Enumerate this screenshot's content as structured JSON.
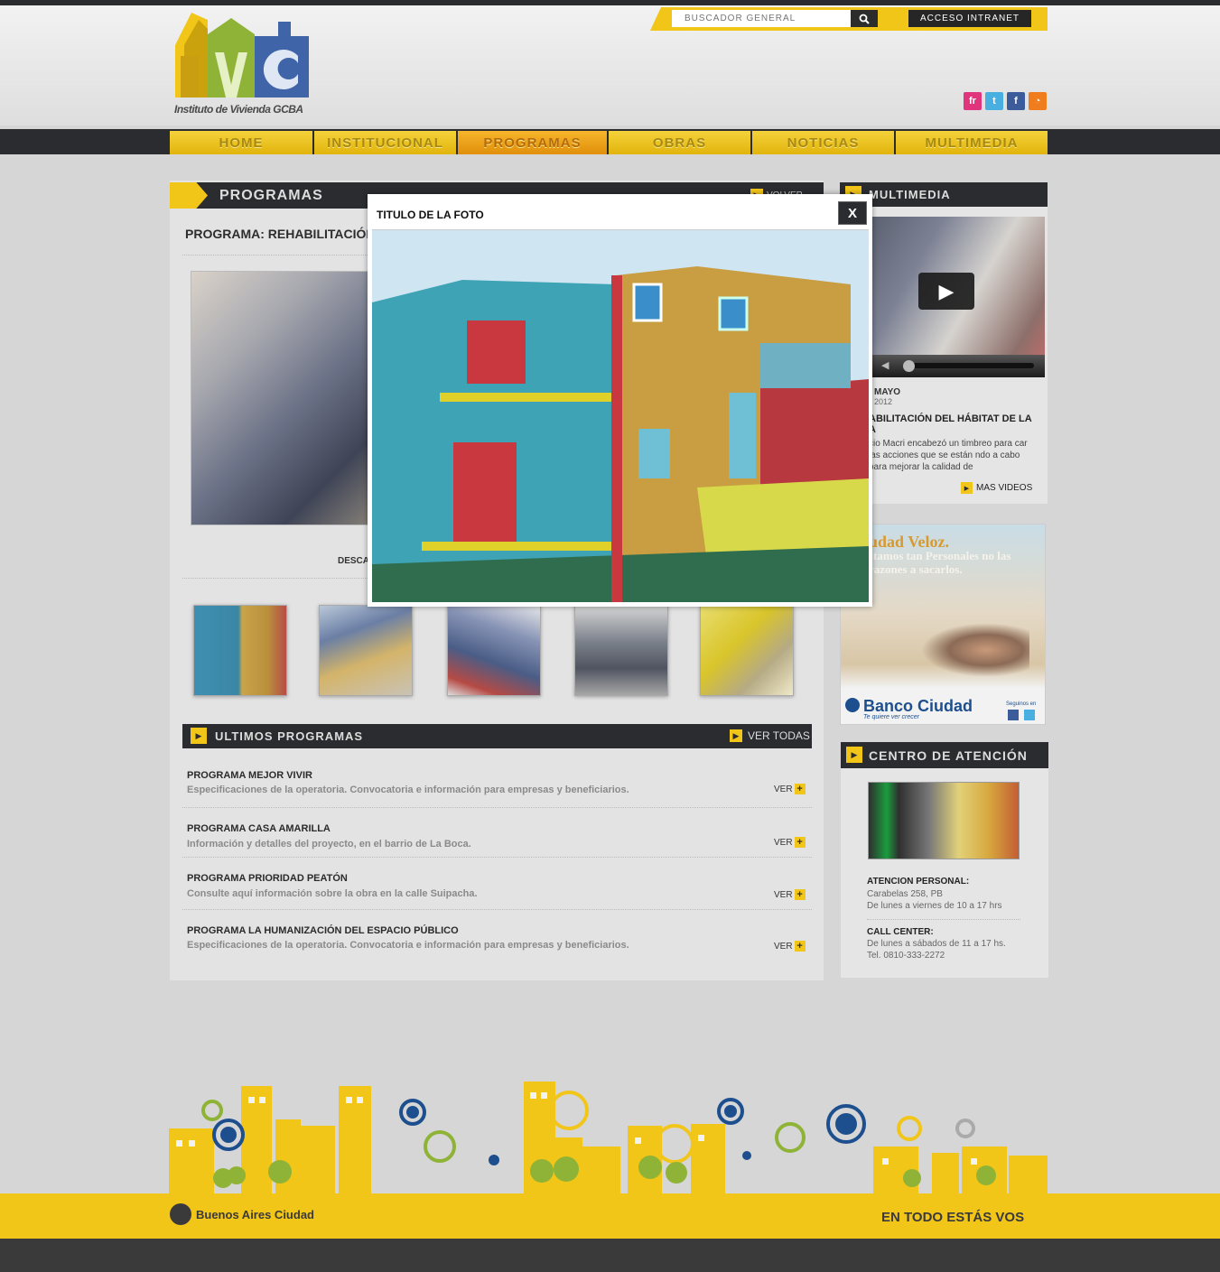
{
  "header": {
    "logo_text": "Instituto de Vivienda GCBA",
    "search_placeholder": "BUSCADOR GENERAL",
    "intranet_label": "ACCESO INTRANET",
    "social": [
      {
        "icon": "flickr-icon",
        "glyph": "fr",
        "color": "#e0347c"
      },
      {
        "icon": "twitter-icon",
        "glyph": "t",
        "color": "#49aee0"
      },
      {
        "icon": "facebook-icon",
        "glyph": "f",
        "color": "#3b5b9a"
      },
      {
        "icon": "rss-icon",
        "glyph": "◔",
        "color": "#ef7d1d"
      }
    ]
  },
  "nav": {
    "items": [
      "HOME",
      "INSTITUCIONAL",
      "PROGRAMAS",
      "OBRAS",
      "NOTICIAS",
      "MULTIMEDIA"
    ],
    "active": "PROGRAMAS"
  },
  "main": {
    "section_title": "PROGRAMAS",
    "back_label": "VOLVER",
    "program_title": "PROGRAMA: REHABILITACIÓN",
    "download_label": "DESCA"
  },
  "ultimos": {
    "title": "ULTIMOS PROGRAMAS",
    "see_all": "VER TODAS",
    "more_label": "VER",
    "items": [
      {
        "title": "PROGRAMA MEJOR VIVIR",
        "desc": "Especificaciones de la operatoria. Convocatoria e información para empresas y beneficiarios."
      },
      {
        "title": "PROGRAMA CASA AMARILLA",
        "desc": "Información y detalles del proyecto, en el barrio de La Boca."
      },
      {
        "title": "PROGRAMA PRIORIDAD PEATÓN",
        "desc": "Consulte aquí información sobre la obra en la calle Suipacha."
      },
      {
        "title": "PROGRAMA LA HUMANIZACIÓN DEL ESPACIO PÚBLICO",
        "desc": "Especificaciones de la operatoria. Convocatoria e información para empresas y beneficiarios."
      }
    ]
  },
  "sidebar": {
    "multimedia_title": "MULTIMEDIA",
    "video_month": "MAYO",
    "video_year": "2012",
    "video_title": "ABILITACIÓN DEL HÁBITAT DE LA A",
    "video_text": "cio Macri encabezó un timbreo para car las acciones que se están ndo a cabo para mejorar la calidad de",
    "more_videos": "MAS VIDEOS",
    "banner_head": "udad Veloz.",
    "banner_sub": "stamos tan Personales no las razones a sacarlos.",
    "banner_bank": "Banco Ciudad",
    "banner_slogan": "Te quiere ver crecer",
    "banner_follow": "Seguinos en",
    "centro_title": "CENTRO DE ATENCIÓN",
    "personal_title": "ATENCION PERSONAL:",
    "personal_addr": "Carabelas 258, PB",
    "personal_hours": "De lunes a viernes de 10 a 17 hrs",
    "call_title": "CALL CENTER:",
    "call_hours": "De lunes a sábados de 11 a 17 hs.",
    "call_tel": "Tel. 0810-333-2272"
  },
  "footer": {
    "city_label": "Buenos Aires Ciudad",
    "slogan": "EN TODO ESTÁS VOS"
  },
  "modal": {
    "title": "TITULO DE LA FOTO",
    "close_label": "X"
  },
  "colors": {
    "accent": "#f2c519",
    "dark": "#2b2c30"
  }
}
